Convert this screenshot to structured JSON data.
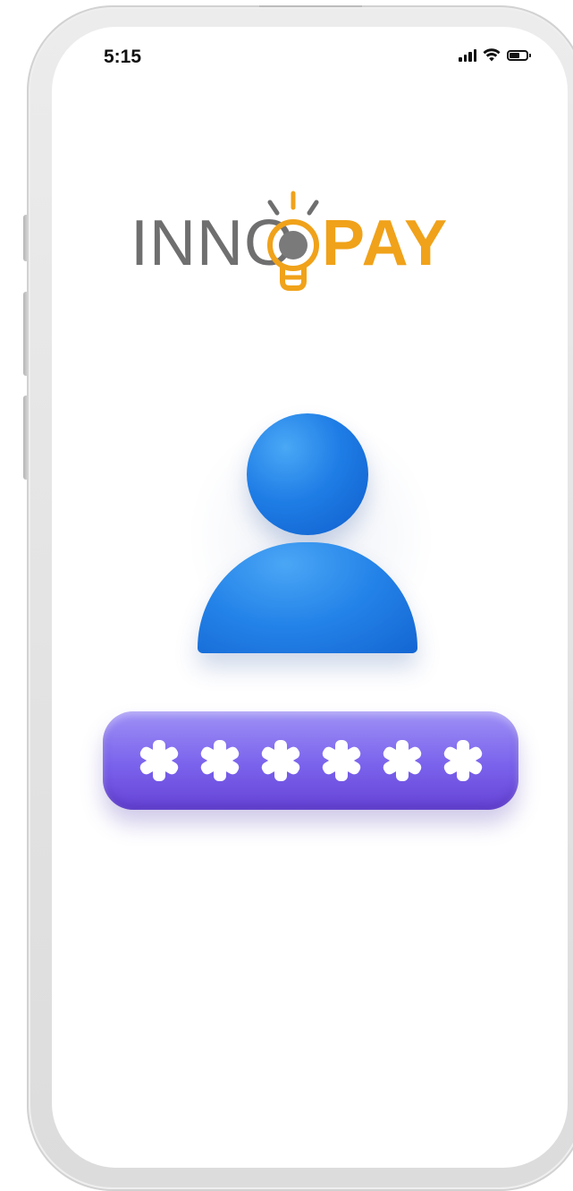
{
  "status_bar": {
    "time": "5:15",
    "icons": [
      "signal-icon",
      "wifi-icon",
      "battery-icon"
    ]
  },
  "logo": {
    "text_left": "INNO",
    "text_right": "PAY",
    "icon": "lightbulb-icon",
    "colors": {
      "gray": "#6f6f6f",
      "orange": "#f0a21a"
    }
  },
  "user": {
    "icon": "user-avatar-icon",
    "color": "#1f7de6"
  },
  "password": {
    "masked_chars": 6,
    "icon": "asterisk-icon",
    "color": "#7a62ec"
  },
  "device": {
    "frame_color": "#e6e6e6"
  }
}
